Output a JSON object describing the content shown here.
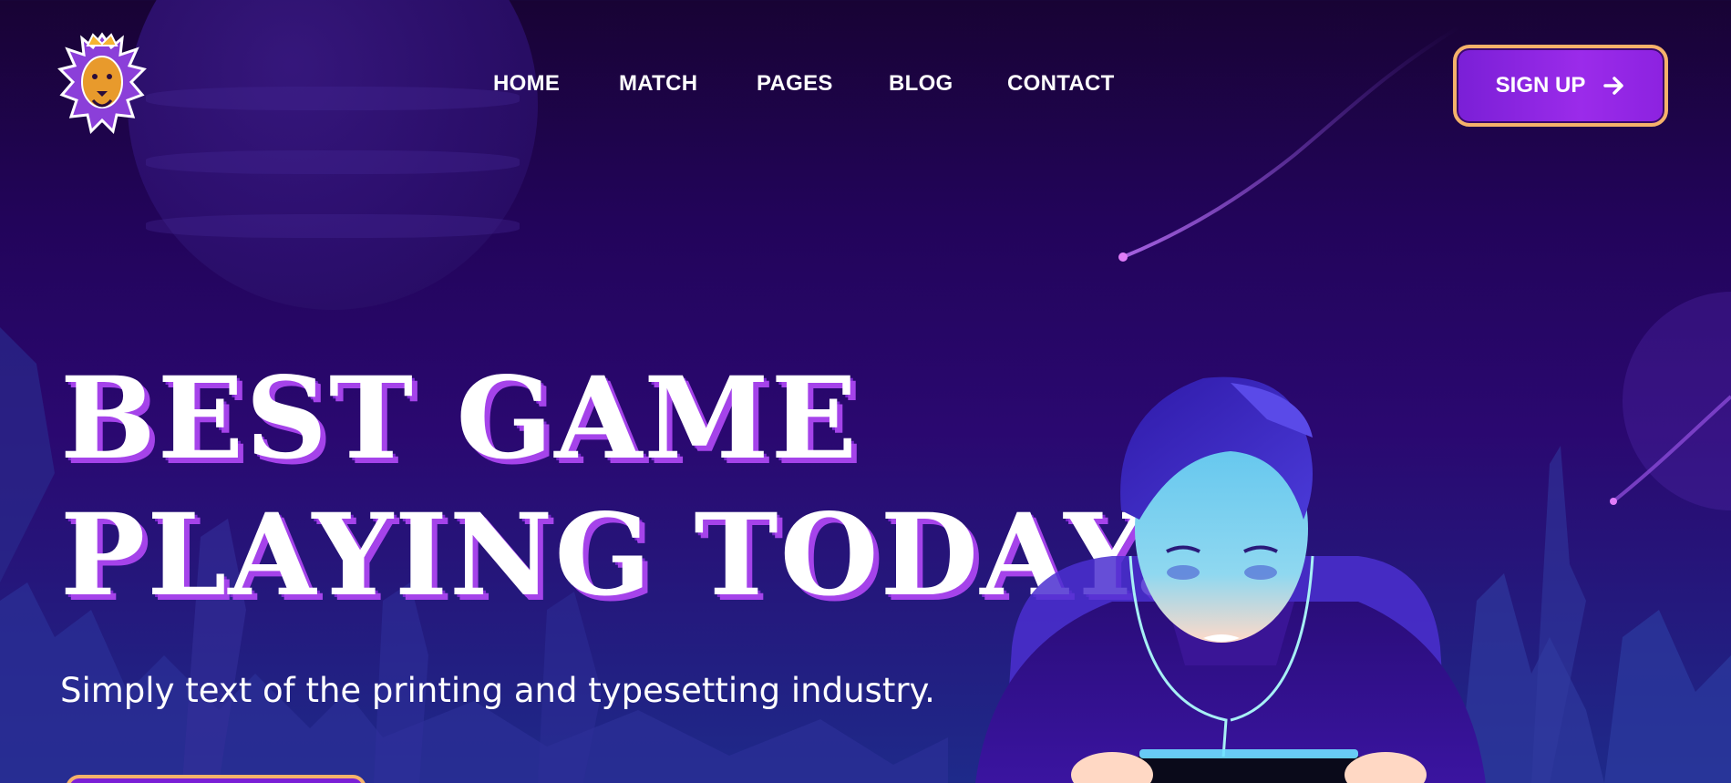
{
  "nav": {
    "items": [
      {
        "label": "HOME"
      },
      {
        "label": "MATCH"
      },
      {
        "label": "PAGES"
      },
      {
        "label": "BLOG"
      },
      {
        "label": "CONTACT"
      }
    ],
    "signup_label": "SIGN UP",
    "signup_icon": "arrow-right-icon"
  },
  "hero": {
    "title_line1": "BEST GAME",
    "title_line2": "PLAYING TODAY.",
    "subtitle": "Simply text of the printing and typesetting industry."
  },
  "colors": {
    "background_top": "#180334",
    "background_bottom": "#1e2a8a",
    "button_fill": "#9b2bea",
    "button_border": "#f5b26a",
    "title_shadow": "#a543ea"
  }
}
